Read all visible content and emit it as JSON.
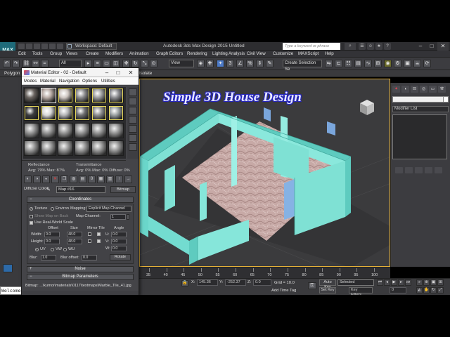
{
  "app": {
    "logo_text": "MAX",
    "workspace": "Workspace: Default",
    "title": "Autodesk 3ds Max Design 2015     Untitled",
    "search_placeholder": "Type a keyword or phrase"
  },
  "menu": [
    "Edit",
    "Tools",
    "Group",
    "Views",
    "Create",
    "Modifiers",
    "Animation",
    "Graph Editors",
    "Rendering",
    "Lighting Analysis",
    "Civil View",
    "Customize",
    "MAXScript",
    "Help"
  ],
  "toolbar": {
    "selection_filter": "All",
    "ref_coord": "View",
    "named_sel": "Create Selection Se"
  },
  "ribbon": {
    "polygon_label": "Polygon",
    "isolate_label": "Isolate"
  },
  "viewport": {
    "overlay_title": "Simple 3D House Design"
  },
  "command_panel": {
    "modifier_list": "Modifier List"
  },
  "material_editor": {
    "title": "Material Editor - 02 - Default",
    "menu": [
      "Modes",
      "Material",
      "Navigation",
      "Options",
      "Utilities"
    ],
    "reflectance_label": "Reflectance",
    "reflectance_values": "Avg: 79% Max: 87%",
    "transmittance_label": "Transmittance",
    "transmittance_values": "Avg:  0% Max:  0%  Diffuse: 0%",
    "diffuse_color_label": "Diffuse Color:",
    "map_name": "Map #16",
    "map_type": "Bitmap",
    "coordinates_rollout": "Coordinates",
    "texture_label": "Texture",
    "environ_label": "Environ",
    "mapping_label": "Mapping:",
    "mapping_value": "Explicit Map Channel",
    "show_map_on_back": "Show Map on Back",
    "map_channel_label": "Map Channel:",
    "map_channel_value": "1",
    "use_real_world": "Use Real-World Scale",
    "offset_label": "Offset",
    "size_label": "Size",
    "mirror_tile_label": "Mirror Tile",
    "angle_label": "Angle",
    "width_label": "Width:",
    "height_label": "Height:",
    "width_offset": "0.0",
    "width_size": "48.0",
    "height_offset": "0.0",
    "height_size": "48.0",
    "u_label": "U:",
    "v_label": "V:",
    "w_label": "W:",
    "u_angle": "0.0",
    "v_angle": "0.0",
    "w_angle": "0.0",
    "uv_label": "UV",
    "vw_label": "VW",
    "wu_label": "WU",
    "blur_label": "Blur:",
    "blur_value": "1.0",
    "blur_offset_label": "Blur offset:",
    "blur_offset_value": "0.0",
    "rotate_label": "Rotate",
    "noise_rollout": "Noise",
    "bitmap_params_rollout": "Bitmap Parameters",
    "bitmap_label": "Bitmap:",
    "bitmap_path": "...\\kumor\\materials\\0117\\textmaps\\Marble_Tile_41.jpg"
  },
  "timeline": {
    "ticks": [
      "35",
      "40",
      "45",
      "50",
      "55",
      "60",
      "65",
      "70",
      "75",
      "80",
      "85",
      "90",
      "95",
      "100"
    ]
  },
  "status": {
    "x_label": "X:",
    "x_value": "145.36",
    "y_label": "Y:",
    "y_value": "-252.37",
    "z_label": "Z:",
    "z_value": "0.0",
    "grid": "Grid = 10.0",
    "add_time_tag": "Add Time Tag",
    "auto_key": "Auto Key",
    "set_key": "Set Key",
    "selected": "Selected",
    "key_filters": "Key Filters...",
    "frame": "0"
  },
  "listener": {
    "text": "Welcome"
  },
  "colors": {
    "accent_border": "#e8b339",
    "wall": "#7fe1d4",
    "floor": "#c7a9a6",
    "panel_dark": "#3a3a3d",
    "title_blue": "#2b2bd0"
  }
}
